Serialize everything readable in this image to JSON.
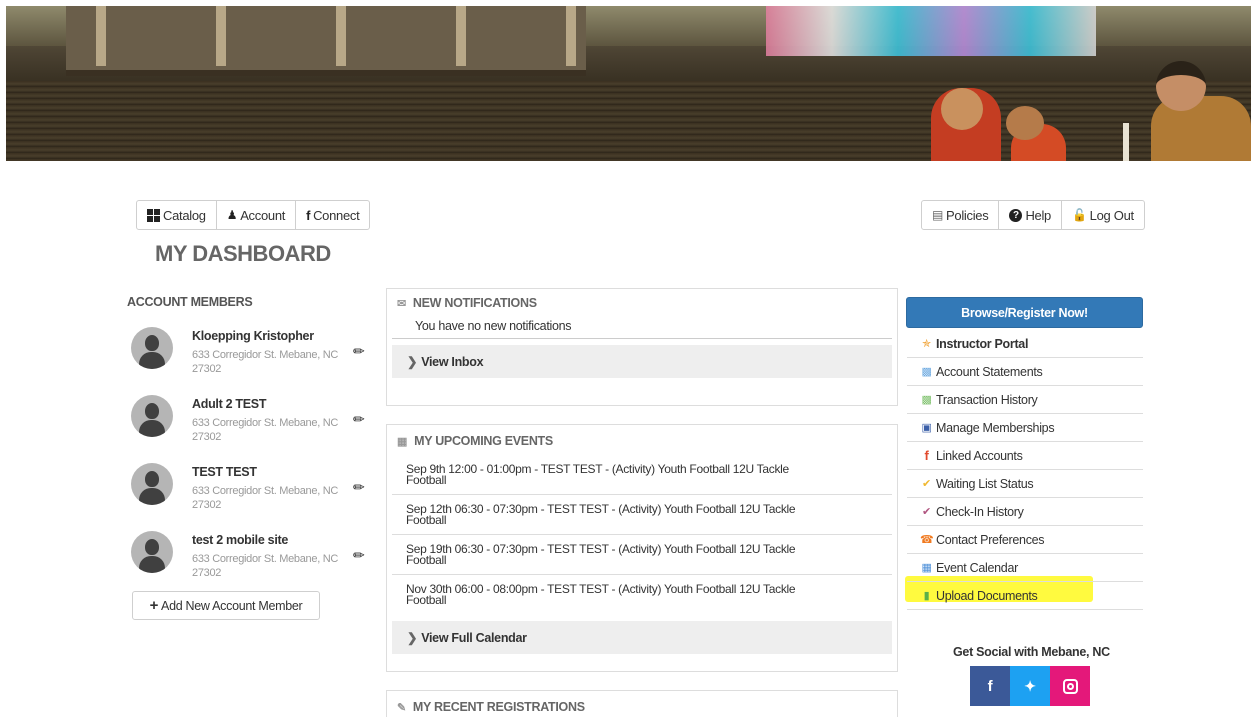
{
  "nav_left": {
    "catalog": "Catalog",
    "account": "Account",
    "connect": "Connect"
  },
  "nav_right": {
    "policies": "Policies",
    "help": "Help",
    "logout": "Log Out"
  },
  "page_title": "MY DASHBOARD",
  "account_members": {
    "title": "ACCOUNT MEMBERS",
    "members": [
      {
        "name": "Kloepping Kristopher",
        "address": "633 Corregidor St. Mebane, NC 27302"
      },
      {
        "name": "Adult 2 TEST",
        "address": "633 Corregidor St. Mebane, NC 27302"
      },
      {
        "name": "TEST TEST",
        "address": "633 Corregidor St. Mebane, NC 27302"
      },
      {
        "name": "test 2 mobile site",
        "address": "633 Corregidor St. Mebane, NC 27302"
      }
    ],
    "add_label": "Add New Account Member"
  },
  "notifications": {
    "title": "NEW NOTIFICATIONS",
    "message": "You have no new notifications",
    "view_inbox": "View Inbox"
  },
  "events": {
    "title": "MY UPCOMING EVENTS",
    "items": [
      {
        "line1": "Sep 9th 12:00 - 01:00pm - TEST TEST - (Activity) Youth Football 12U Tackle",
        "line2": "Football"
      },
      {
        "line1": "Sep 12th 06:30 - 07:30pm - TEST TEST - (Activity) Youth Football 12U Tackle",
        "line2": "Football"
      },
      {
        "line1": "Sep 19th 06:30 - 07:30pm - TEST TEST - (Activity) Youth Football 12U Tackle",
        "line2": "Football"
      },
      {
        "line1": "Nov 30th 06:00 - 08:00pm - TEST TEST - (Activity) Youth Football 12U Tackle",
        "line2": "Football"
      }
    ],
    "view_calendar": "View Full Calendar"
  },
  "registrations": {
    "title": "MY RECENT REGISTRATIONS"
  },
  "sidebar": {
    "browse": "Browse/Register Now!",
    "items": [
      {
        "label": "Instructor Portal",
        "icon": "instructor-icon",
        "color": "#f0a030"
      },
      {
        "label": "Account Statements",
        "icon": "statements-icon",
        "color": "#6aa8e0"
      },
      {
        "label": "Transaction History",
        "icon": "transaction-icon",
        "color": "#7cc06a"
      },
      {
        "label": "Manage Memberships",
        "icon": "membership-card-icon",
        "color": "#3b5fa8"
      },
      {
        "label": "Linked Accounts",
        "icon": "facebook-icon",
        "color": "#e14a2e"
      },
      {
        "label": "Waiting List Status",
        "icon": "checkmark-icon",
        "color": "#f0b830"
      },
      {
        "label": "Check-In History",
        "icon": "checkmark-icon",
        "color": "#b05580"
      },
      {
        "label": "Contact Preferences",
        "icon": "phone-icon",
        "color": "#f07a20"
      },
      {
        "label": "Event Calendar",
        "icon": "calendar-icon",
        "color": "#4a8ed8"
      },
      {
        "label": "Upload Documents",
        "icon": "document-icon",
        "color": "#5ab04a"
      }
    ]
  },
  "social": {
    "title": "Get Social with Mebane, NC",
    "facebook_color": "#3b5998",
    "twitter_color": "#1da1f2",
    "instagram_color": "#e4187a"
  },
  "accent_color": "#3379b7",
  "highlight_color": "#fffa2a"
}
